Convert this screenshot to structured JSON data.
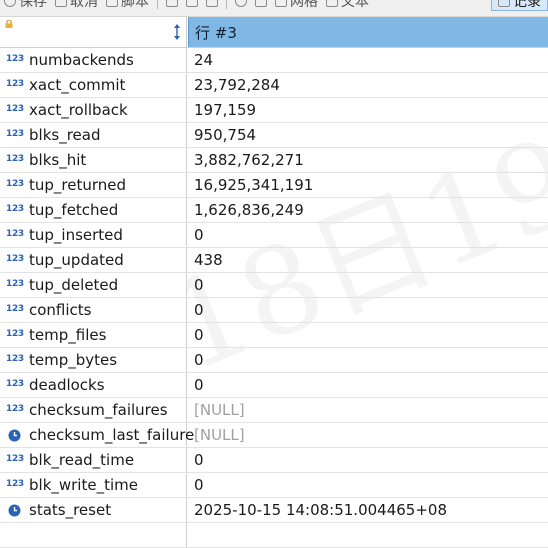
{
  "toolbar": {
    "save_label": "保存",
    "cancel_label": "取消",
    "script_label": "脚本",
    "grid_label": "网格",
    "text_label": "文本",
    "record_label": "记录"
  },
  "header": {
    "column_title": "行 #3"
  },
  "rows": [
    {
      "name": "numbackends",
      "type": "number",
      "value": "24"
    },
    {
      "name": "xact_commit",
      "type": "number",
      "value": "23,792,284"
    },
    {
      "name": "xact_rollback",
      "type": "number",
      "value": "197,159"
    },
    {
      "name": "blks_read",
      "type": "number",
      "value": "950,754"
    },
    {
      "name": "blks_hit",
      "type": "number",
      "value": "3,882,762,271"
    },
    {
      "name": "tup_returned",
      "type": "number",
      "value": "16,925,341,191"
    },
    {
      "name": "tup_fetched",
      "type": "number",
      "value": "1,626,836,249"
    },
    {
      "name": "tup_inserted",
      "type": "number",
      "value": "0"
    },
    {
      "name": "tup_updated",
      "type": "number",
      "value": "438"
    },
    {
      "name": "tup_deleted",
      "type": "number",
      "value": "0"
    },
    {
      "name": "conflicts",
      "type": "number",
      "value": "0"
    },
    {
      "name": "temp_files",
      "type": "number",
      "value": "0"
    },
    {
      "name": "temp_bytes",
      "type": "number",
      "value": "0"
    },
    {
      "name": "deadlocks",
      "type": "number",
      "value": "0"
    },
    {
      "name": "checksum_failures",
      "type": "number",
      "value": "[NULL]"
    },
    {
      "name": "checksum_last_failure",
      "type": "timestamp",
      "value": "[NULL]"
    },
    {
      "name": "blk_read_time",
      "type": "number",
      "value": "0"
    },
    {
      "name": "blk_write_time",
      "type": "number",
      "value": "0"
    },
    {
      "name": "stats_reset",
      "type": "timestamp",
      "value": "2025-10-15 14:08:51.004465+08"
    }
  ],
  "type_icon_text": "123",
  "watermark": "月18日19",
  "colors": {
    "header_bg": "#7fb7e5",
    "number_icon": "#2a63b5",
    "timestamp_icon": "#2a63b5",
    "null_text": "#a0a0a0"
  }
}
